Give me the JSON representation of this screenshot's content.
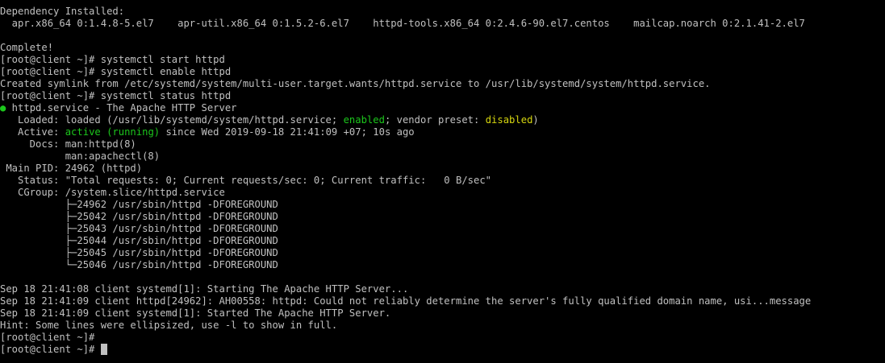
{
  "colors": {
    "background": "#000000",
    "text": "#c0c0c0",
    "green": "#1cc71c",
    "yellow": "#d6d60f"
  },
  "terminal": {
    "lines": [
      [
        {
          "text": "Dependency Installed:"
        }
      ],
      [
        {
          "text": "  apr.x86_64 0:1.4.8-5.el7    apr-util.x86_64 0:1.5.2-6.el7    httpd-tools.x86_64 0:2.4.6-90.el7.centos    mailcap.noarch 0:2.1.41-2.el7"
        }
      ],
      [
        {
          "text": ""
        }
      ],
      [
        {
          "text": "Complete!"
        }
      ],
      [
        {
          "text": "[root@client ~]# systemctl start httpd"
        }
      ],
      [
        {
          "text": "[root@client ~]# systemctl enable httpd"
        }
      ],
      [
        {
          "text": "Created symlink from /etc/systemd/system/multi-user.target.wants/httpd.service to /usr/lib/systemd/system/httpd.service."
        }
      ],
      [
        {
          "text": "[root@client ~]# systemctl status httpd"
        }
      ],
      [
        {
          "text": "●",
          "style": "green"
        },
        {
          "text": " httpd.service - The Apache HTTP Server"
        }
      ],
      [
        {
          "text": "   Loaded: loaded (/usr/lib/systemd/system/httpd.service; "
        },
        {
          "text": "enabled",
          "style": "green"
        },
        {
          "text": "; vendor preset: "
        },
        {
          "text": "disabled",
          "style": "yellow"
        },
        {
          "text": ")"
        }
      ],
      [
        {
          "text": "   Active: "
        },
        {
          "text": "active (running)",
          "style": "green"
        },
        {
          "text": " since Wed 2019-09-18 21:41:09 +07; 10s ago"
        }
      ],
      [
        {
          "text": "     Docs: man:httpd(8)"
        }
      ],
      [
        {
          "text": "           man:apachectl(8)"
        }
      ],
      [
        {
          "text": " Main PID: 24962 (httpd)"
        }
      ],
      [
        {
          "text": "   Status: \"Total requests: 0; Current requests/sec: 0; Current traffic:   0 B/sec\""
        }
      ],
      [
        {
          "text": "   CGroup: /system.slice/httpd.service"
        }
      ],
      [
        {
          "text": "           ├─24962 /usr/sbin/httpd -DFOREGROUND"
        }
      ],
      [
        {
          "text": "           ├─25042 /usr/sbin/httpd -DFOREGROUND"
        }
      ],
      [
        {
          "text": "           ├─25043 /usr/sbin/httpd -DFOREGROUND"
        }
      ],
      [
        {
          "text": "           ├─25044 /usr/sbin/httpd -DFOREGROUND"
        }
      ],
      [
        {
          "text": "           ├─25045 /usr/sbin/httpd -DFOREGROUND"
        }
      ],
      [
        {
          "text": "           └─25046 /usr/sbin/httpd -DFOREGROUND"
        }
      ],
      [
        {
          "text": ""
        }
      ],
      [
        {
          "text": "Sep 18 21:41:08 client systemd[1]: Starting The Apache HTTP Server..."
        }
      ],
      [
        {
          "text": "Sep 18 21:41:09 client httpd[24962]: AH00558: httpd: Could not reliably determine the server's fully qualified domain name, usi...message"
        }
      ],
      [
        {
          "text": "Sep 18 21:41:09 client systemd[1]: Started The Apache HTTP Server."
        }
      ],
      [
        {
          "text": "Hint: Some lines were ellipsized, use -l to show in full."
        }
      ],
      [
        {
          "text": "[root@client ~]#"
        }
      ],
      [
        {
          "text": "[root@client ~]# "
        },
        {
          "cursor": true
        }
      ]
    ]
  }
}
